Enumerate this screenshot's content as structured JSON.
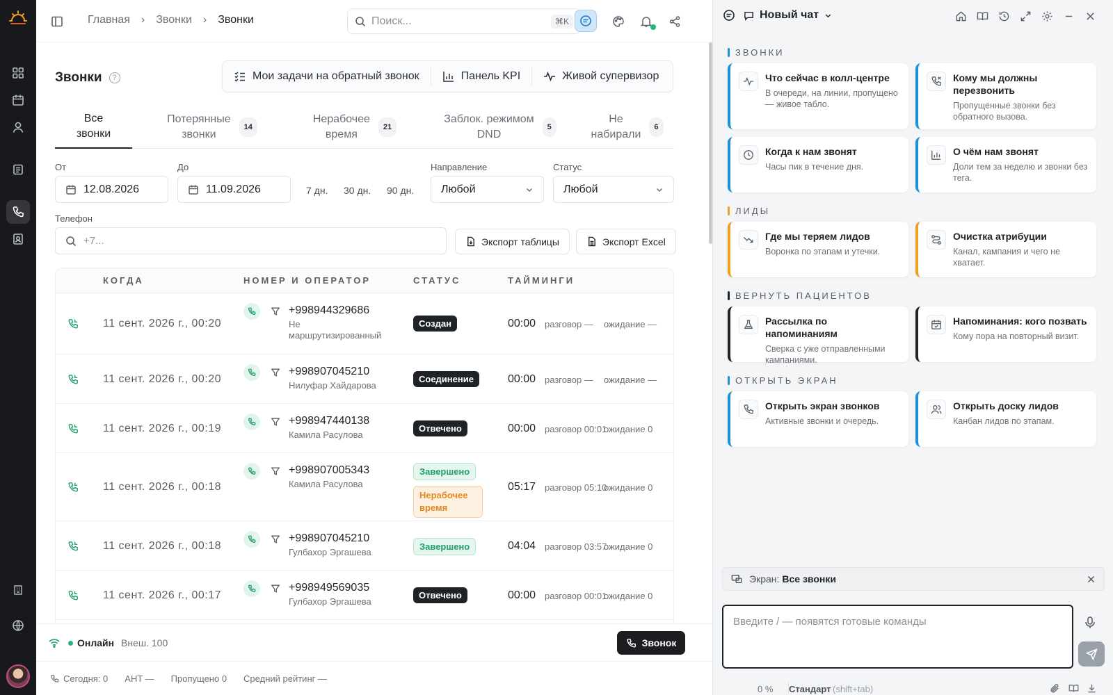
{
  "topbar": {
    "breadcrumbs": [
      "Главная",
      "Звонки",
      "Звонки"
    ],
    "search_placeholder": "Поиск...",
    "search_shortcut": "⌘K"
  },
  "page": {
    "title": "Звонки",
    "help": "?",
    "actions": [
      "Мои задачи на обратный звонок",
      "Панель KPI",
      "Живой супервизор"
    ]
  },
  "tabs": [
    {
      "label": "Все\nзвонки",
      "count": ""
    },
    {
      "label": "Потерянные\nзвонки",
      "count": "14"
    },
    {
      "label": "Нерабочее\nвремя",
      "count": "21"
    },
    {
      "label": "Заблок. режимом\nDND",
      "count": "5"
    },
    {
      "label": "Не\nнабирали",
      "count": "6"
    }
  ],
  "filters": {
    "from_label": "От",
    "from_value": "12.08.2026",
    "to_label": "До",
    "to_value": "11.09.2026",
    "quick_ranges": [
      "7 дн.",
      "30 дн.",
      "90 дн."
    ],
    "direction_label": "Направление",
    "direction_value": "Любой",
    "status_label": "Статус",
    "status_value": "Любой",
    "phone_label": "Телефон",
    "phone_placeholder": "+7...",
    "export_table": "Экспорт таблицы",
    "export_excel": "Экспорт Excel"
  },
  "table": {
    "headers": [
      "КОГДА",
      "НОМЕР И ОПЕРАТОР",
      "СТАТУС",
      "ТАЙМИНГИ"
    ],
    "rows": [
      {
        "when": "11 сент. 2026 г., 00:20",
        "number": "+998944329686",
        "operator": "Не маршрутизированный",
        "statuses": [
          {
            "text": "Создан",
            "kind": "dark"
          }
        ],
        "time": "00:00",
        "talk": "разговор —",
        "wait": "ожидание —"
      },
      {
        "when": "11 сент. 2026 г., 00:20",
        "number": "+998907045210",
        "operator": "Нилуфар Хайдарова",
        "statuses": [
          {
            "text": "Соединение",
            "kind": "dark"
          }
        ],
        "time": "00:00",
        "talk": "разговор —",
        "wait": "ожидание —"
      },
      {
        "when": "11 сент. 2026 г., 00:19",
        "number": "+998947440138",
        "operator": "Камила Расулова",
        "statuses": [
          {
            "text": "Отвечено",
            "kind": "dark"
          }
        ],
        "time": "00:00",
        "talk": "разговор 00:01",
        "wait": "ожидание 0"
      },
      {
        "when": "11 сент. 2026 г., 00:18",
        "number": "+998907005343",
        "operator": "Камила Расулова",
        "statuses": [
          {
            "text": "Завершено",
            "kind": "green"
          },
          {
            "text": "Нерабочее время",
            "kind": "orange"
          }
        ],
        "time": "05:17",
        "talk": "разговор 05:10",
        "wait": "ожидание 0"
      },
      {
        "when": "11 сент. 2026 г., 00:18",
        "number": "+998907045210",
        "operator": "Гулбахор Эргашева",
        "statuses": [
          {
            "text": "Завершено",
            "kind": "green"
          }
        ],
        "time": "04:04",
        "talk": "разговор 03:57",
        "wait": "ожидание 0"
      },
      {
        "when": "11 сент. 2026 г., 00:17",
        "number": "+998949569035",
        "operator": "Гулбахор Эргашева",
        "statuses": [
          {
            "text": "Отвечено",
            "kind": "dark"
          }
        ],
        "time": "00:00",
        "talk": "разговор 00:01",
        "wait": "ожидание 0"
      }
    ]
  },
  "statusbar": {
    "online": "Онлайн",
    "ext": "Внеш. 100",
    "call_button": "Звонок"
  },
  "footer": {
    "today": "Сегодня: 0",
    "aht": "AHT —",
    "missed": "Пропущено 0",
    "rating": "Средний рейтинг —"
  },
  "panel": {
    "title": "Новый чат",
    "sections": [
      {
        "title": "ЗВОНКИ",
        "color": "#1e90d8",
        "cards": [
          {
            "title": "Что сейчас в колл-центре",
            "desc": "В очереди, на линии, пропущено — живое табло.",
            "icon": "pulse-icon"
          },
          {
            "title": "Кому мы должны перезвонить",
            "desc": "Пропущенные звонки без обратного вызова.",
            "icon": "missed-call-icon"
          },
          {
            "title": "Когда к нам звонят",
            "desc": "Часы пик в течение дня.",
            "icon": "clock-icon"
          },
          {
            "title": "О чём нам звонят",
            "desc": "Доли тем за неделю и звонки без тега.",
            "icon": "bar-chart-icon"
          }
        ]
      },
      {
        "title": "ЛИДЫ",
        "color": "#f0a020",
        "cards": [
          {
            "title": "Где мы теряем лидов",
            "desc": "Воронка по этапам и утечки.",
            "icon": "trend-down-icon"
          },
          {
            "title": "Очистка атрибуции",
            "desc": "Канал, кампания и чего не хватает.",
            "icon": "route-icon"
          }
        ]
      },
      {
        "title": "ВЕРНУТЬ ПАЦИЕНТОВ",
        "color": "#1f2328",
        "cards": [
          {
            "title": "Рассылка по напоминаниям",
            "desc": "Сверка с уже отправленными кампаниями.",
            "icon": "flask-icon"
          },
          {
            "title": "Напоминания: кого позвать",
            "desc": "Кому пора на повторный визит.",
            "icon": "calendar-check-icon"
          }
        ]
      },
      {
        "title": "ОТКРЫТЬ ЭКРАН",
        "color": "#1e90d8",
        "cards": [
          {
            "title": "Открыть экран звонков",
            "desc": "Активные звонки и очередь.",
            "icon": "phone-icon"
          },
          {
            "title": "Открыть доску лидов",
            "desc": "Канбан лидов по этапам.",
            "icon": "users-icon"
          }
        ]
      }
    ],
    "screen_label": "Экран:",
    "screen_value": "Все звонки",
    "input_placeholder": "Введите / — появятся готовые команды",
    "percent": "0 %",
    "mode": "Стандарт",
    "mode_hint": "(shift+tab)"
  }
}
